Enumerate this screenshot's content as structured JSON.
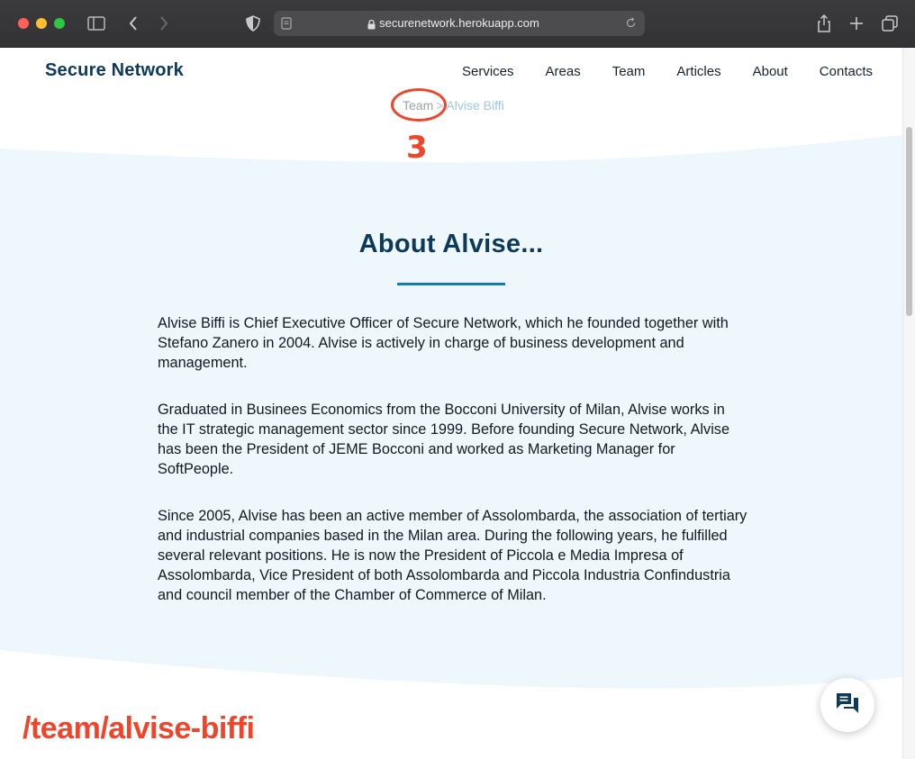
{
  "browser": {
    "url": "securenetwork.herokuapp.com",
    "icons": [
      "sidebar-icon",
      "back-icon",
      "forward-icon",
      "shield-icon",
      "reader-icon",
      "lock-icon",
      "reload-icon",
      "share-icon",
      "plus-icon",
      "tabs-icon"
    ]
  },
  "header": {
    "brand": "Secure Network",
    "nav": [
      "Services",
      "Areas",
      "Team",
      "Articles",
      "About",
      "Contacts"
    ]
  },
  "breadcrumb": {
    "parent": "Team",
    "separator": ">",
    "current": "Alvise Biffi"
  },
  "annotations": {
    "step_number": "3",
    "url_path": "/team/alvise-biffi",
    "color": "#f0442b"
  },
  "main": {
    "title": "About Alvise...",
    "paragraphs": [
      "Alvise Biffi is Chief Executive Officer of Secure Network, which he founded together with Stefano Zanero in 2004. Alvise is actively in charge of business development and management.",
      "Graduated in Businees Economics from the Bocconi University of Milan, Alvise works in the IT strategic management sector since 1999. Before founding Secure Network, Alvise has been the President of JEME Bocconi and worked as Marketing Manager for SoftPeople.",
      "Since 2005, Alvise has been an active member of Assolombarda, the association of tertiary and industrial companies based in the Milan area. During the following years, he fulfilled several relevant positions. He is now the President of Piccola e Media Impresa of Assolombarda, Vice President of both Assolombarda and Piccola Industria Confindustria and council member of the Chamber of Commerce of Milan."
    ]
  },
  "colors": {
    "brand": "#0e3a5a",
    "band": "#eef7fc",
    "accent": "#1579b2"
  },
  "chat": {
    "icon": "chat-icon"
  }
}
